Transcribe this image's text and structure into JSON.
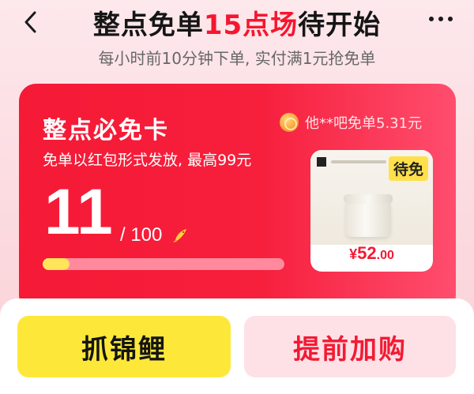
{
  "header": {
    "title_prefix": "整点免单",
    "title_highlight": "15点场",
    "title_suffix": "待开始",
    "subtitle": "每小时前10分钟下单, 实付满1元抢免单",
    "more_label": "···"
  },
  "card": {
    "title": "整点必免卡",
    "description": "免单以红包形式发放, 最高99元",
    "recent_winner": "他**吧免单5.31元",
    "current_count": "11",
    "total_count": "/ 100",
    "progress_fraction": 0.11,
    "product": {
      "badge": "待免",
      "price_symbol": "¥",
      "price_integer": "52",
      "price_decimal": ".00"
    }
  },
  "actions": {
    "grab_koi": "抓锦鲤",
    "add_to_cart": "提前加购"
  },
  "colors": {
    "accent_red": "#f6162f",
    "yellow": "#fde83a",
    "pink_button": "#fde1e6"
  },
  "icons": {
    "back": "chevron-left-icon",
    "more": "more-horizontal-icon",
    "coin": "coin-avatar-icon",
    "koi": "koi-fish-icon"
  }
}
